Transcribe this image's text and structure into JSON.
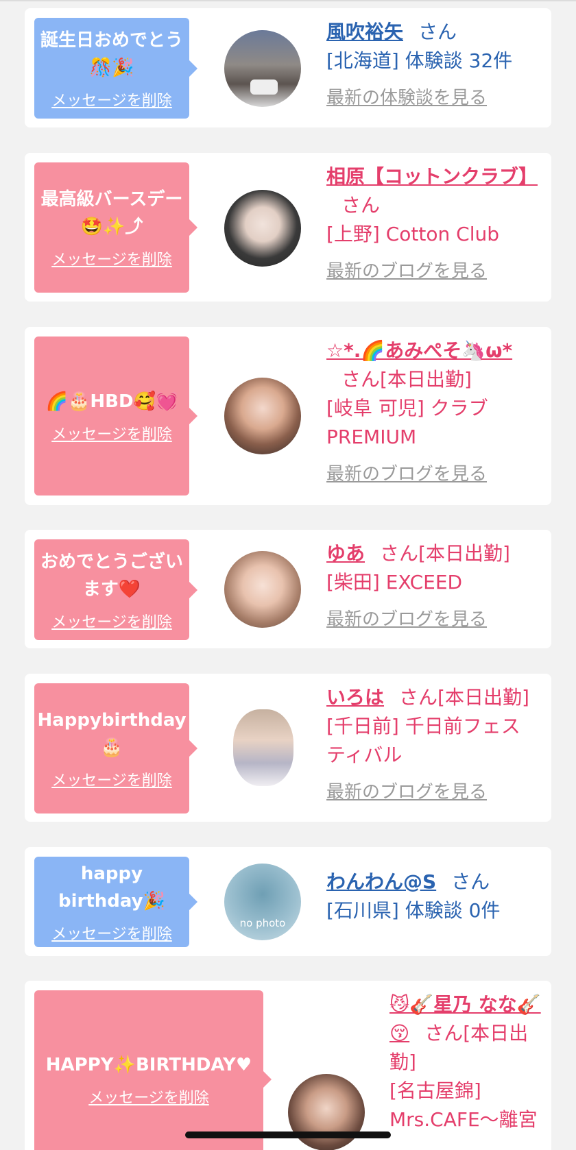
{
  "cards": [
    {
      "message": "誕生日おめでとう🎊🎉",
      "delete_label": "メッセージを削除",
      "name": "風吹裕矢",
      "honorific": "さん",
      "status": "",
      "location_line": "[北海道] 体験談 32件",
      "link": "最新の体験談を見る"
    },
    {
      "message": "最高級バースデー🤩✨⤴",
      "delete_label": "メッセージを削除",
      "name": "相原【コットンクラブ】",
      "honorific": "さん",
      "status": "",
      "location_line": "[上野] Cotton Club",
      "link": "最新のブログを見る"
    },
    {
      "message": "🌈🎂HBD🥰💓",
      "delete_label": "メッセージを削除",
      "name": "☆*.🌈あみぺそ🦄ω*",
      "honorific": "さん",
      "status": "[本日出勤]",
      "location_line": "[岐阜 可児] クラブPREMIUM",
      "link": "最新のブログを見る"
    },
    {
      "message": "おめでとうございます❤️",
      "delete_label": "メッセージを削除",
      "name": "ゆあ",
      "honorific": "さん",
      "status": "[本日出勤]",
      "location_line": "[柴田] EXCEED",
      "link": "最新のブログを見る"
    },
    {
      "message": "Happybirthday🎂",
      "delete_label": "メッセージを削除",
      "name": "いろは",
      "honorific": "さん",
      "status": "[本日出勤]",
      "location_line": "[千日前] 千日前フェスティバル",
      "link": "最新のブログを見る"
    },
    {
      "message": "happy birthday🎉",
      "delete_label": "メッセージを削除",
      "name": "わんわん@S",
      "honorific": "さん",
      "status": "",
      "location_line": "[石川県] 体験談 0件",
      "link": "",
      "avatar_text": "no photo"
    },
    {
      "message": "HAPPY✨BIRTHDAY♥",
      "delete_label": "メッセージを削除",
      "name": "😼🎸星乃 なな🎸😚",
      "honorific": "さん",
      "status": "[本日出勤]",
      "location_line": "[名古屋錦] Mrs.CAFE〜離宮",
      "link": ""
    }
  ],
  "colors": {
    "member_bubble": "#8ab5f5",
    "cast_bubble": "#f7909f",
    "member_text": "#2a63b0",
    "cast_text": "#e43e6b"
  }
}
